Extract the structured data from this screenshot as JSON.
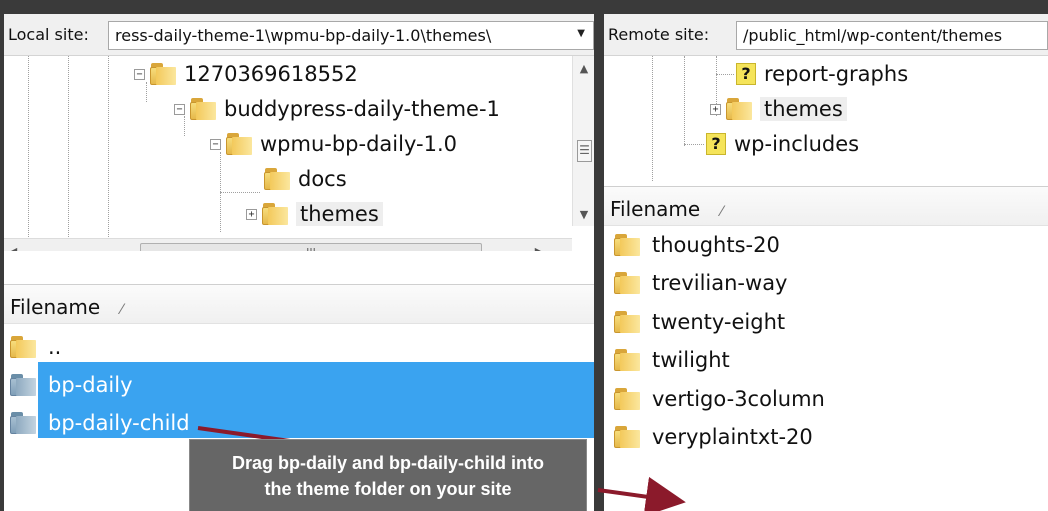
{
  "local": {
    "label": "Local site:",
    "path": "ress-daily-theme-1\\wpmu-bp-daily-1.0\\themes\\",
    "tree": [
      {
        "label": "1270369618552",
        "expander": "−"
      },
      {
        "label": "buddypress-daily-theme-1",
        "expander": "−"
      },
      {
        "label": "wpmu-bp-daily-1.0",
        "expander": "−"
      },
      {
        "label": "docs",
        "expander": ""
      },
      {
        "label": "themes",
        "expander": "+"
      }
    ],
    "filename_header": "Filename",
    "files": [
      {
        "name": "..",
        "selected": false
      },
      {
        "name": "bp-daily",
        "selected": true
      },
      {
        "name": "bp-daily-child",
        "selected": true
      }
    ]
  },
  "remote": {
    "label": "Remote site:",
    "path": "/public_html/wp-content/themes",
    "tree": [
      {
        "label": "report-graphs",
        "expander": "",
        "icon": "question-icon"
      },
      {
        "label": "themes",
        "expander": "+",
        "icon": "folder-icon"
      },
      {
        "label": "wp-includes",
        "expander": "",
        "icon": "question-icon"
      }
    ],
    "filename_header": "Filename",
    "files": [
      {
        "name": "thoughts-20"
      },
      {
        "name": "trevilian-way"
      },
      {
        "name": "twenty-eight"
      },
      {
        "name": "twilight"
      },
      {
        "name": "vertigo-3column"
      },
      {
        "name": "veryplaintxt-20"
      }
    ]
  },
  "scroll": {
    "up": "▲",
    "down": "▼",
    "left": "◀",
    "right": "▶",
    "grip_v": "☰",
    "grip_h": "III"
  },
  "sort_glyph": "⁄",
  "combo_arrow": "▼",
  "callout": {
    "line1": "Drag bp-daily and bp-daily-child into",
    "line2": "the theme folder on your site"
  },
  "colors": {
    "selection": "#3aa3f0",
    "arrow": "#8b1a2b",
    "callout_bg": "#666666"
  }
}
